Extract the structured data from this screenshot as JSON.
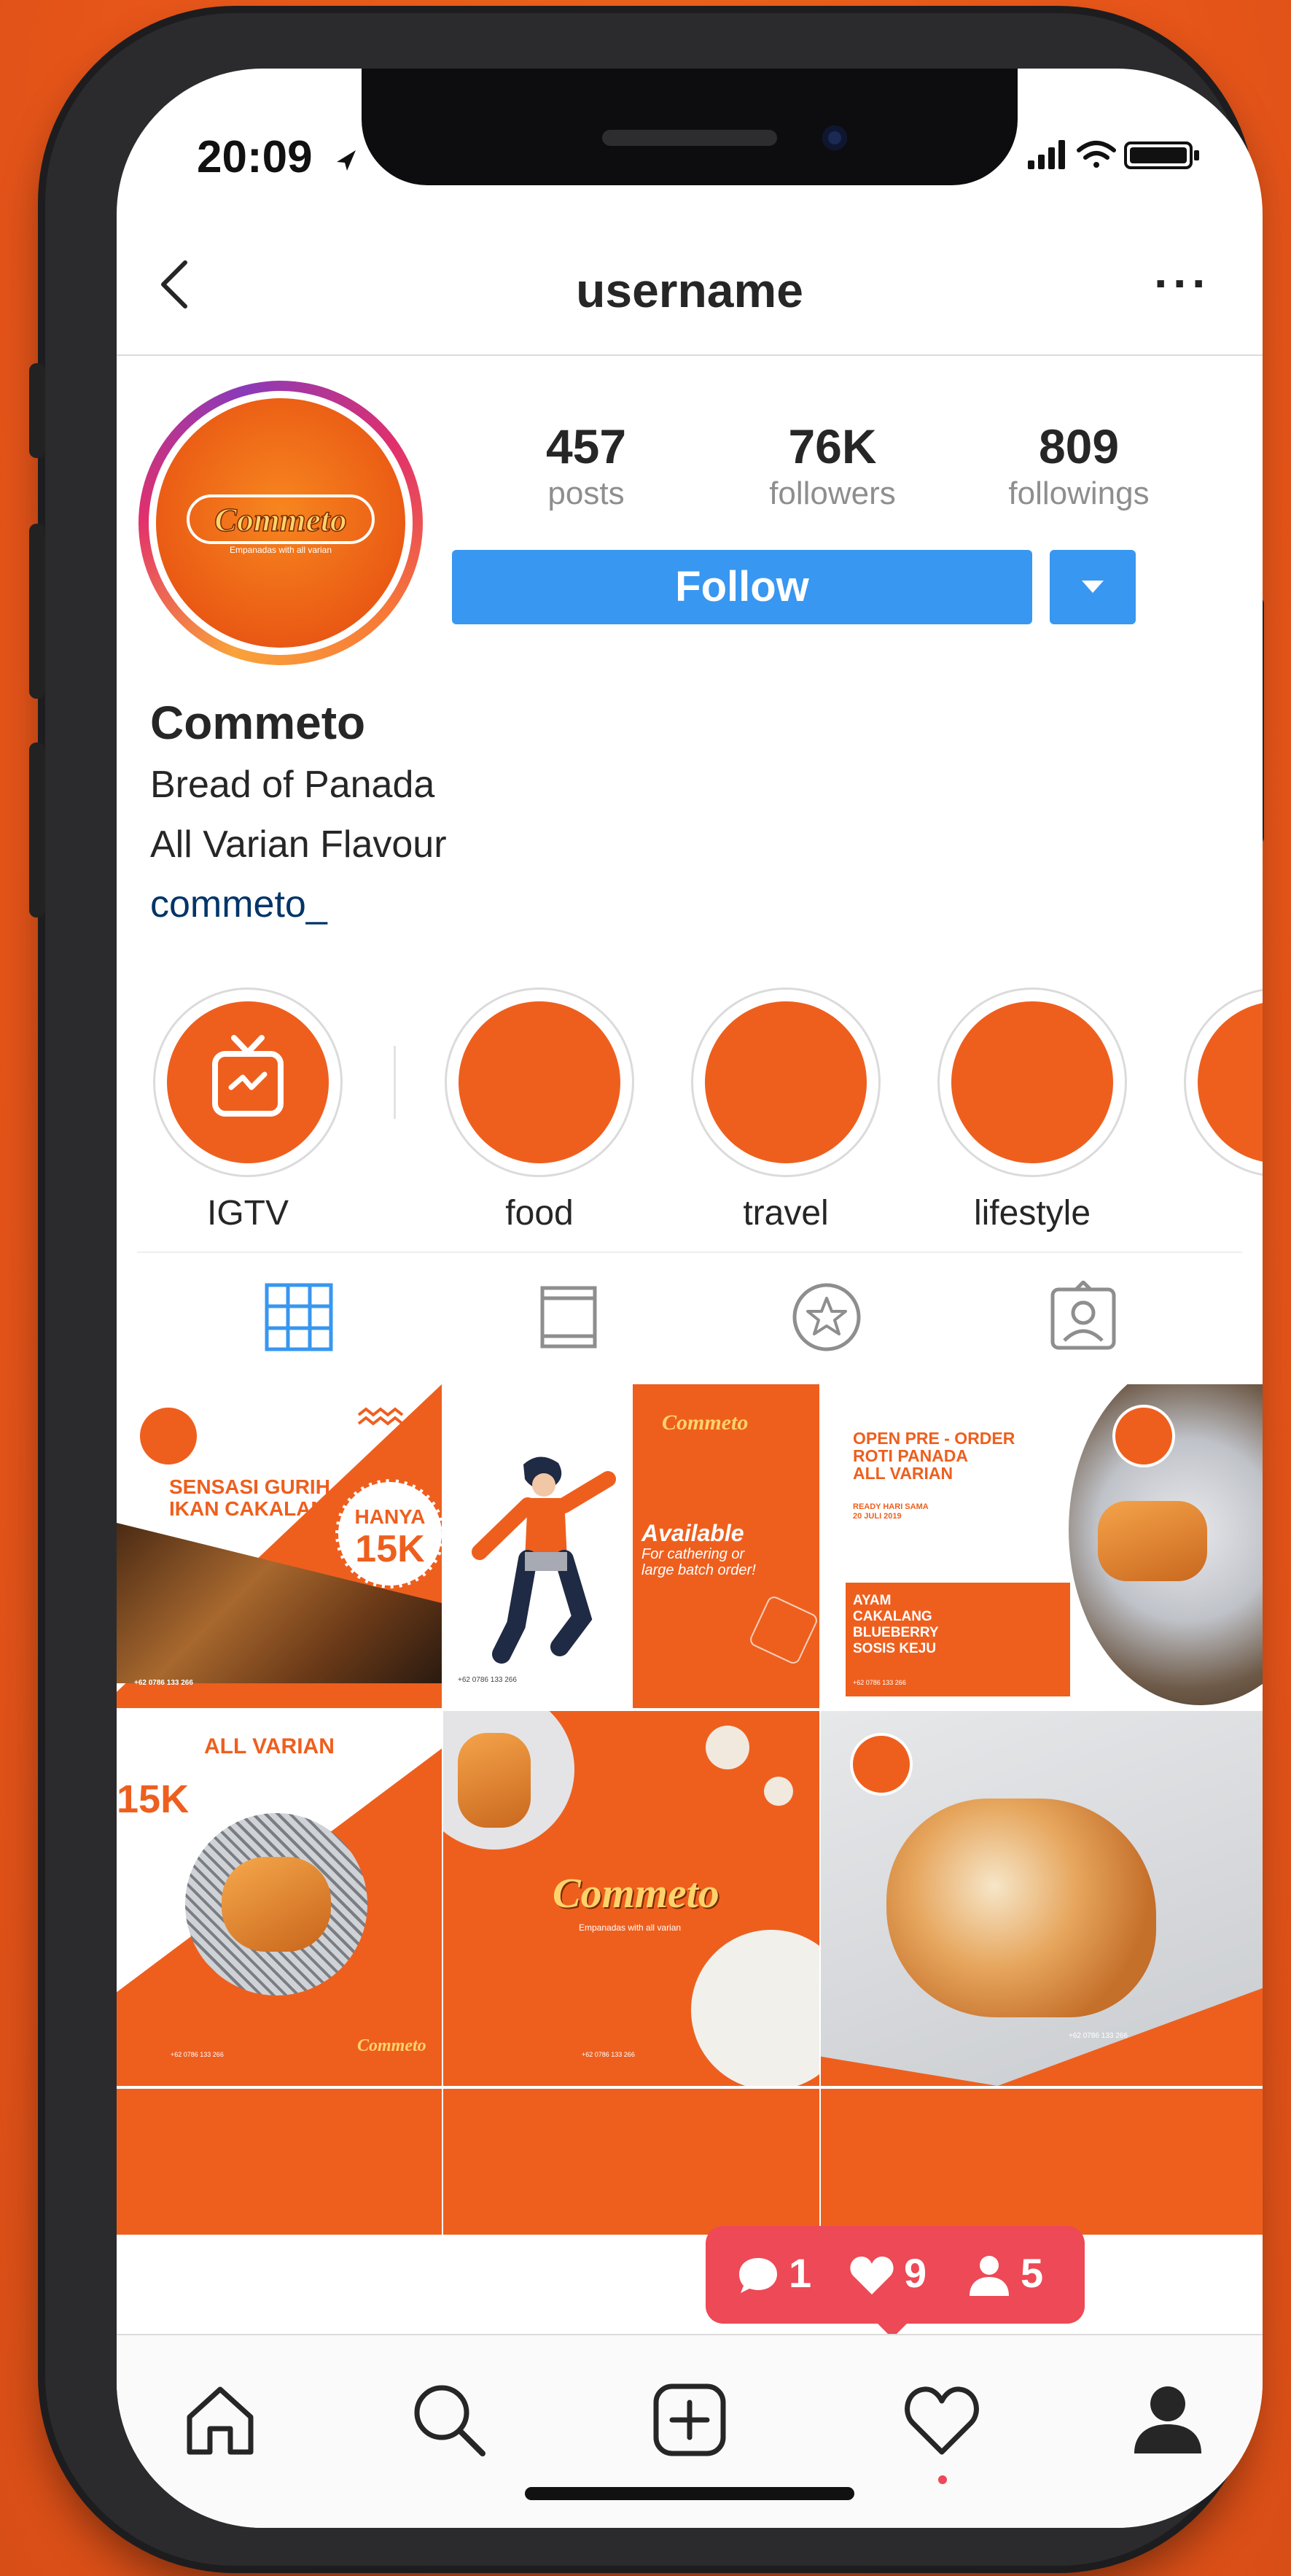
{
  "status_bar": {
    "time": "20:09"
  },
  "header": {
    "title": "username",
    "more_label": "···"
  },
  "profile": {
    "logo_text": "Commeto",
    "logo_tagline": "Empanadas with all varian",
    "stats": [
      {
        "value": "457",
        "label": "posts"
      },
      {
        "value": "76K",
        "label": "followers"
      },
      {
        "value": "809",
        "label": "followings"
      }
    ],
    "follow_label": "Follow",
    "name": "Commeto",
    "bio_lines": [
      "Bread of Panada",
      "All Varian Flavour"
    ],
    "link": "commeto_"
  },
  "highlights": [
    {
      "label": "IGTV",
      "icon": "igtv-icon"
    },
    {
      "label": "food"
    },
    {
      "label": "travel"
    },
    {
      "label": "lifestyle"
    },
    {
      "label": ""
    }
  ],
  "tabs": [
    {
      "icon": "grid-icon",
      "active": true
    },
    {
      "icon": "feed-icon",
      "active": false
    },
    {
      "icon": "star-icon",
      "active": false
    },
    {
      "icon": "tagged-user-icon",
      "active": false
    }
  ],
  "posts": {
    "p1": {
      "headline": "SENSASI GURIH\nIKAN CAKALANG!",
      "badge_top": "HANYA",
      "badge_price": "15K",
      "contact": "+62 0786 133 266"
    },
    "p2": {
      "brand": "Commeto",
      "headline": "Available",
      "sub": "For cathering or\nlarge batch order!",
      "contact": "+62 0786 133 266"
    },
    "p3": {
      "headline": "OPEN PRE - ORDER\nROTI PANADA\nALL VARIAN",
      "date": "READY HARI SAMA\n20 JULI 2019",
      "flavours": "AYAM\nCAKALANG\nBLUEBERRY\nSOSIS KEJU",
      "contact": "+62 0786 133 266"
    },
    "p4": {
      "headline": "ALL VARIAN",
      "price": "15K",
      "brand": "Commeto",
      "contact": "+62 0786 133 266"
    },
    "p5": {
      "brand": "Commeto",
      "tagline": "Empanadas with all varian",
      "contact": "+62 0786 133 266"
    },
    "p6": {
      "contact": "+62 0786 133 266"
    }
  },
  "notification": {
    "comments": "1",
    "likes": "9",
    "follows": "5"
  },
  "colors": {
    "brand": "#ee5f1e",
    "follow_blue": "#3897f0",
    "notif_red": "#ed4956",
    "link_blue": "#003569"
  }
}
